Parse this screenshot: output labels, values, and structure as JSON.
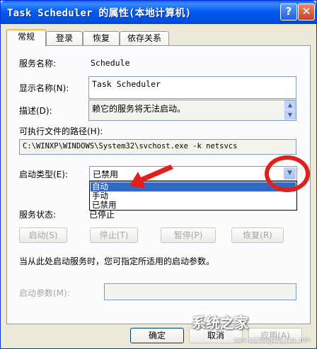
{
  "window": {
    "title": "Task Scheduler 的属性(本地计算机)",
    "help_glyph": "?",
    "close_glyph": "✕"
  },
  "tabs": [
    {
      "label": "常规"
    },
    {
      "label": "登录"
    },
    {
      "label": "恢复"
    },
    {
      "label": "依存关系"
    }
  ],
  "general": {
    "service_name_label": "服务名称:",
    "service_name_value": "Schedule",
    "display_name_label": "显示名称(N):",
    "display_name_value": "Task Scheduler",
    "description_label": "描述(D):",
    "description_value": "赖它的服务将无法启动。",
    "path_label": "可执行文件的路径(H):",
    "path_value": "C:\\WINXP\\WINDOWS\\System32\\svchost.exe -k netsvcs",
    "startup_type_label": "启动类型(E):",
    "startup_type_value": "已禁用",
    "startup_options": [
      "自动",
      "手动",
      "已禁用"
    ],
    "service_status_label": "服务状态:",
    "service_status_value": "已停止",
    "start_button": "启动(S)",
    "stop_button": "停止(T)",
    "pause_button": "暂停(P)",
    "resume_button": "恢复(R)",
    "hint_text": "当从此处启动服务时，您可指定所适用的启动参数。",
    "start_params_label": "启动参数(M):",
    "start_params_value": ""
  },
  "footer": {
    "ok_button": "确定",
    "cancel_button": "取消",
    "apply_button": "应用(A)"
  },
  "watermark": {
    "text": "系统之家",
    "url": "www.xitongzhijia.net"
  },
  "colors": {
    "titlebar": "#0058EE",
    "highlight": "#316AC5",
    "annotation": "#E2201B",
    "face": "#ECE9D8"
  }
}
